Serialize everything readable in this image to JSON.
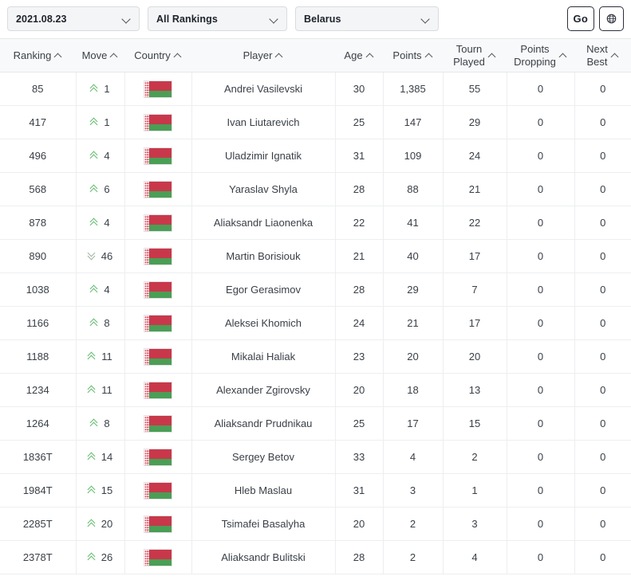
{
  "toolbar": {
    "date_select": {
      "value": "2021.08.23",
      "icon": "chevron-down-icon"
    },
    "ranking_select": {
      "value": "All Rankings",
      "icon": "chevron-down-icon"
    },
    "nation_select": {
      "value": "Belarus",
      "icon": "chevron-down-icon"
    },
    "go_button": {
      "label": "Go"
    },
    "globe_button": {
      "icon": "globe-icon",
      "label": ""
    }
  },
  "table": {
    "columns": [
      {
        "label": "Ranking",
        "sort_icon": "caret-up-icon",
        "two_line": false
      },
      {
        "label": "Move",
        "sort_icon": "caret-up-icon",
        "two_line": false
      },
      {
        "label": "Country",
        "sort_icon": "caret-up-icon",
        "two_line": false
      },
      {
        "label": "Player",
        "sort_icon": "caret-up-icon",
        "two_line": false
      },
      {
        "label": "Age",
        "sort_icon": "caret-up-icon",
        "two_line": false
      },
      {
        "label": "Points",
        "sort_icon": "caret-up-icon",
        "two_line": false
      },
      {
        "label": "Tourn\nPlayed",
        "sort_icon": "caret-up-icon",
        "two_line": true
      },
      {
        "label": "Points\nDropping",
        "sort_icon": "caret-up-icon",
        "two_line": true
      },
      {
        "label": "Next\nBest",
        "sort_icon": "caret-up-icon",
        "two_line": true
      }
    ],
    "country_flag": "belarus-flag",
    "rows": [
      {
        "ranking": "85",
        "move_dir": "up",
        "move": "1",
        "player": "Andrei Vasilevski",
        "age": "30",
        "points": "1,385",
        "tourn_played": "55",
        "points_dropping": "0",
        "next_best": "0"
      },
      {
        "ranking": "417",
        "move_dir": "up",
        "move": "1",
        "player": "Ivan Liutarevich",
        "age": "25",
        "points": "147",
        "tourn_played": "29",
        "points_dropping": "0",
        "next_best": "0"
      },
      {
        "ranking": "496",
        "move_dir": "up",
        "move": "4",
        "player": "Uladzimir Ignatik",
        "age": "31",
        "points": "109",
        "tourn_played": "24",
        "points_dropping": "0",
        "next_best": "0"
      },
      {
        "ranking": "568",
        "move_dir": "up",
        "move": "6",
        "player": "Yaraslav Shyla",
        "age": "28",
        "points": "88",
        "tourn_played": "21",
        "points_dropping": "0",
        "next_best": "0"
      },
      {
        "ranking": "878",
        "move_dir": "up",
        "move": "4",
        "player": "Aliaksandr Liaonenka",
        "age": "22",
        "points": "41",
        "tourn_played": "22",
        "points_dropping": "0",
        "next_best": "0"
      },
      {
        "ranking": "890",
        "move_dir": "down",
        "move": "46",
        "player": "Martin Borisiouk",
        "age": "21",
        "points": "40",
        "tourn_played": "17",
        "points_dropping": "0",
        "next_best": "0"
      },
      {
        "ranking": "1038",
        "move_dir": "up",
        "move": "4",
        "player": "Egor Gerasimov",
        "age": "28",
        "points": "29",
        "tourn_played": "7",
        "points_dropping": "0",
        "next_best": "0"
      },
      {
        "ranking": "1166",
        "move_dir": "up",
        "move": "8",
        "player": "Aleksei Khomich",
        "age": "24",
        "points": "21",
        "tourn_played": "17",
        "points_dropping": "0",
        "next_best": "0"
      },
      {
        "ranking": "1188",
        "move_dir": "up",
        "move": "11",
        "player": "Mikalai Haliak",
        "age": "23",
        "points": "20",
        "tourn_played": "20",
        "points_dropping": "0",
        "next_best": "0"
      },
      {
        "ranking": "1234",
        "move_dir": "up",
        "move": "11",
        "player": "Alexander Zgirovsky",
        "age": "20",
        "points": "18",
        "tourn_played": "13",
        "points_dropping": "0",
        "next_best": "0"
      },
      {
        "ranking": "1264",
        "move_dir": "up",
        "move": "8",
        "player": "Aliaksandr Prudnikau",
        "age": "25",
        "points": "17",
        "tourn_played": "15",
        "points_dropping": "0",
        "next_best": "0"
      },
      {
        "ranking": "1836T",
        "move_dir": "up",
        "move": "14",
        "player": "Sergey Betov",
        "age": "33",
        "points": "4",
        "tourn_played": "2",
        "points_dropping": "0",
        "next_best": "0"
      },
      {
        "ranking": "1984T",
        "move_dir": "up",
        "move": "15",
        "player": "Hleb Maslau",
        "age": "31",
        "points": "3",
        "tourn_played": "1",
        "points_dropping": "0",
        "next_best": "0"
      },
      {
        "ranking": "2285T",
        "move_dir": "up",
        "move": "20",
        "player": "Tsimafei Basalyha",
        "age": "20",
        "points": "2",
        "tourn_played": "3",
        "points_dropping": "0",
        "next_best": "0"
      },
      {
        "ranking": "2378T",
        "move_dir": "up",
        "move": "26",
        "player": "Aliaksandr Bulitski",
        "age": "28",
        "points": "2",
        "tourn_played": "4",
        "points_dropping": "0",
        "next_best": "0"
      }
    ]
  },
  "colors": {
    "move_up": "#63bb6e",
    "move_down": "#9fb5a3",
    "flag_red": "#c8384a",
    "flag_green": "#4b9e55",
    "header_bg": "#f8f9fa"
  }
}
